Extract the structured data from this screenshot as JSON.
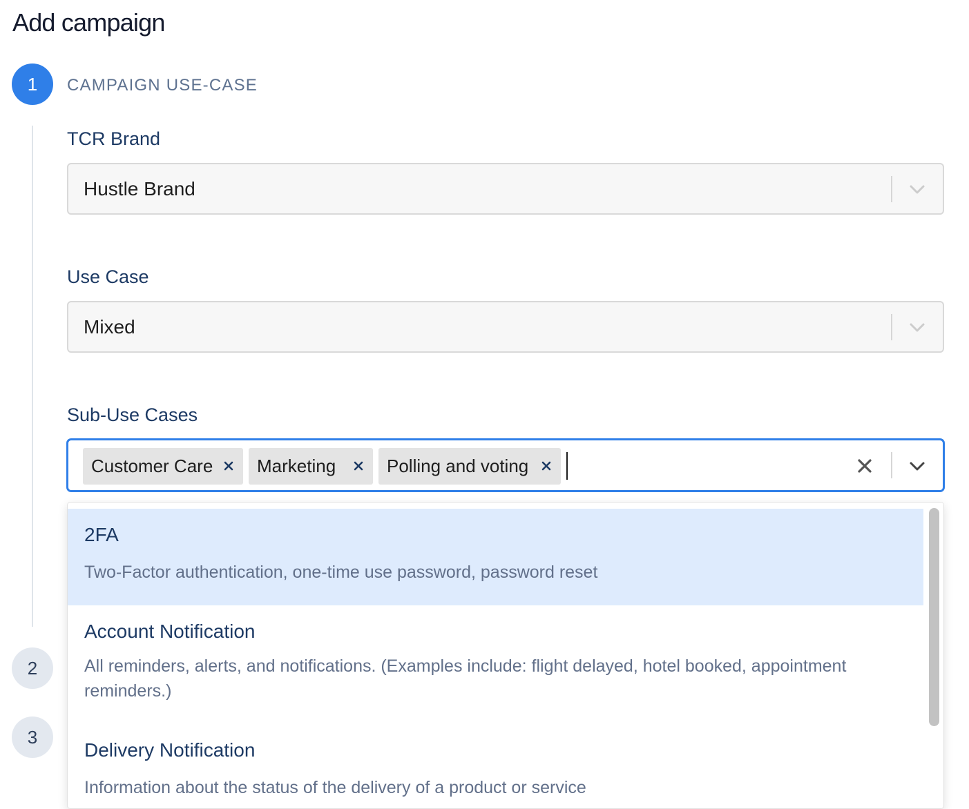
{
  "page": {
    "title": "Add campaign"
  },
  "steps": [
    {
      "number": "1",
      "title": "CAMPAIGN USE-CASE",
      "active": true
    },
    {
      "number": "2",
      "active": false
    },
    {
      "number": "3",
      "active": false
    }
  ],
  "form": {
    "tcr_brand": {
      "label": "TCR Brand",
      "value": "Hustle Brand"
    },
    "use_case": {
      "label": "Use Case",
      "value": "Mixed"
    },
    "sub_use_cases": {
      "label": "Sub-Use Cases",
      "selected": [
        "Customer Care",
        "Marketing",
        "Polling and voting"
      ]
    }
  },
  "dropdown": {
    "options": [
      {
        "title": "2FA",
        "description": "Two-Factor authentication, one-time use password, password reset",
        "highlighted": true
      },
      {
        "title": "Account Notification",
        "description": "All reminders, alerts, and notifications. (Examples include: flight delayed, hotel booked, appointment reminders.)",
        "highlighted": false
      },
      {
        "title": "Delivery Notification",
        "description": "Information about the status of the delivery of a product or service",
        "highlighted": false
      }
    ]
  },
  "colors": {
    "accent": "#2f7fe8",
    "highlight": "#deebfd",
    "label_text": "#1d3a64",
    "muted_text": "#62708a"
  },
  "icons": {
    "chip_remove": "close-icon",
    "clear": "close-icon",
    "dropdown": "chevron-down-icon"
  }
}
